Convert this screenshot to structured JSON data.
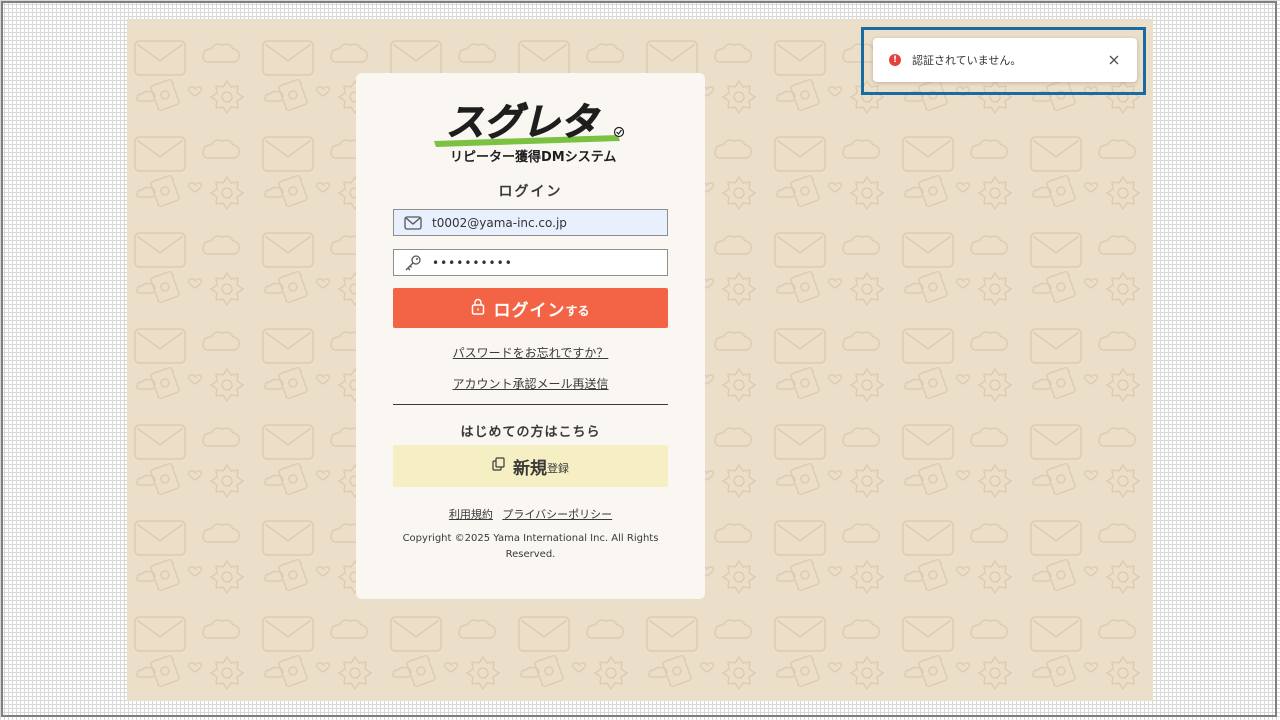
{
  "logo": {
    "main_text": "スグレタ",
    "sub_text": "リピーター獲得DMシステム",
    "accent_color": "#7cc242"
  },
  "login": {
    "title": "ログイン",
    "email_value": "t0002@yama-inc.co.jp",
    "password_value": "••••••••••",
    "submit_label_main": "ログイン",
    "submit_label_suffix": "する",
    "submit_color": "#f26445",
    "forgot_password_link": "パスワードをお忘れですか？",
    "resend_link": "アカウント承認メール再送信"
  },
  "register": {
    "heading": "はじめての方はこちら",
    "button_main": "新規",
    "button_suffix": "登録",
    "button_color": "#f6efc3"
  },
  "footer": {
    "terms_link": "利用規約",
    "privacy_link": "プライバシーポリシー",
    "copyright": "Copyright ©2025 Yama International Inc. All Rights Reserved."
  },
  "toast": {
    "message": "認証されていません。",
    "icon": "error-icon",
    "status_color": "#e5413a",
    "highlight_color": "#1a6aa3"
  },
  "background": {
    "color": "#ebdfca",
    "pattern_icons": [
      "envelope-icon",
      "cloud-icon",
      "stamp-icon",
      "badge-icon",
      "heart-icon"
    ]
  }
}
